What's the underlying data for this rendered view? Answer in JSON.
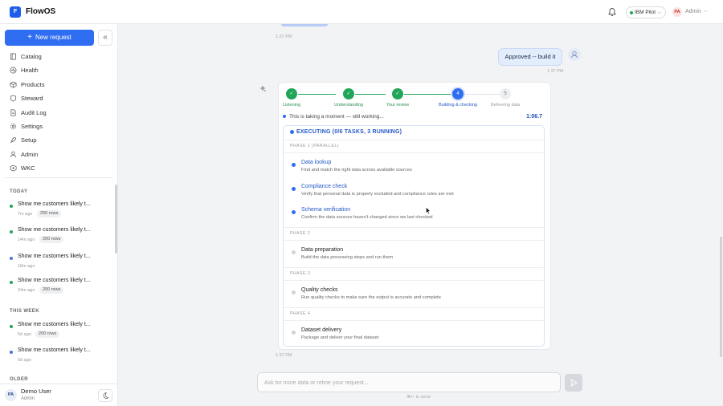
{
  "app": {
    "logo_letter": "F",
    "name": "FlowOS"
  },
  "topbar": {
    "env_label": "IBM Pilot",
    "avatar_initials": "PA",
    "user_label": "Admin"
  },
  "sidebar": {
    "new_request_label": "New request",
    "collapse_glyph": "«",
    "nav": [
      {
        "label": "Catalog",
        "icon": "book-icon"
      },
      {
        "label": "Health",
        "icon": "heart-pulse-icon"
      },
      {
        "label": "Products",
        "icon": "cube-icon"
      },
      {
        "label": "Steward",
        "icon": "shield-icon"
      },
      {
        "label": "Audit Log",
        "icon": "document-icon"
      },
      {
        "label": "Settings",
        "icon": "gear-icon"
      },
      {
        "label": "Setup",
        "icon": "rocket-icon"
      },
      {
        "label": "Admin",
        "icon": "user-icon"
      },
      {
        "label": "WKC",
        "icon": "grid-icon"
      }
    ],
    "sections": {
      "today": "TODAY",
      "this_week": "THIS WEEK",
      "older": "OLDER"
    },
    "history": [
      {
        "title": "Show me customers likely t...",
        "time": "7m ago",
        "badge": "200 rows",
        "status_color": "#22a559"
      },
      {
        "title": "Show me customers likely t...",
        "time": "14m ago",
        "badge": "200 rows",
        "status_color": "#22a559"
      },
      {
        "title": "Show me customers likely t...",
        "time": "18m ago",
        "badge": "",
        "status_color": "#4a73d8"
      },
      {
        "title": "Show me customers likely t...",
        "time": "24m ago",
        "badge": "200 rows",
        "status_color": "#22a559"
      },
      {
        "title": "Show me customers likely t...",
        "time": "5d ago",
        "badge": "200 rows",
        "status_color": "#22a559"
      },
      {
        "title": "Show me customers likely t...",
        "time": "5d ago",
        "badge": "",
        "status_color": "#4a73d8"
      }
    ],
    "footer": {
      "initials": "PA",
      "name": "Demo User",
      "role": "Admin"
    }
  },
  "chat": {
    "timestamps": {
      "prev": "1:37 PM",
      "user": "1:37 PM",
      "card": "1:37 PM"
    },
    "user_message": "Approved -- build it",
    "stepper": [
      {
        "label": "Listening",
        "state": "done",
        "symbol": "✓"
      },
      {
        "label": "Understanding",
        "state": "done",
        "symbol": "✓"
      },
      {
        "label": "Your review",
        "state": "done",
        "symbol": "✓"
      },
      {
        "label": "Building & checking",
        "state": "active",
        "symbol": "4"
      },
      {
        "label": "Delivering data",
        "state": "pending",
        "symbol": "5"
      }
    ],
    "status_text": "This is taking a moment — still working...",
    "timer": "1:06.7",
    "execution": {
      "header": "EXECUTING (0/6 TASKS, 3 RUNNING)",
      "phases": [
        {
          "label": "PHASE 1 (PARALLEL)",
          "tasks": [
            {
              "title": "Data lookup",
              "desc": "Find and match the right data across available sources",
              "state": "running"
            },
            {
              "title": "Compliance check",
              "desc": "Verify that personal data is properly excluded and compliance rules are met",
              "state": "running"
            },
            {
              "title": "Schema verification",
              "desc": "Confirm the data sources haven't changed since we last checked",
              "state": "running"
            }
          ]
        },
        {
          "label": "PHASE 2",
          "tasks": [
            {
              "title": "Data preparation",
              "desc": "Build the data processing steps and run them",
              "state": "pending"
            }
          ]
        },
        {
          "label": "PHASE 3",
          "tasks": [
            {
              "title": "Quality checks",
              "desc": "Run quality checks to make sure the output is accurate and complete",
              "state": "pending"
            }
          ]
        },
        {
          "label": "PHASE 4",
          "tasks": [
            {
              "title": "Dataset delivery",
              "desc": "Package and deliver your final dataset",
              "state": "pending"
            }
          ]
        }
      ]
    },
    "composer": {
      "placeholder": "Ask for more data or refine your request...",
      "hint": "⌘↵ to send"
    }
  },
  "colors": {
    "accent": "#2f6df1",
    "done": "#22a559",
    "running": "#2f6df1",
    "pending": "#d0d3d7"
  }
}
